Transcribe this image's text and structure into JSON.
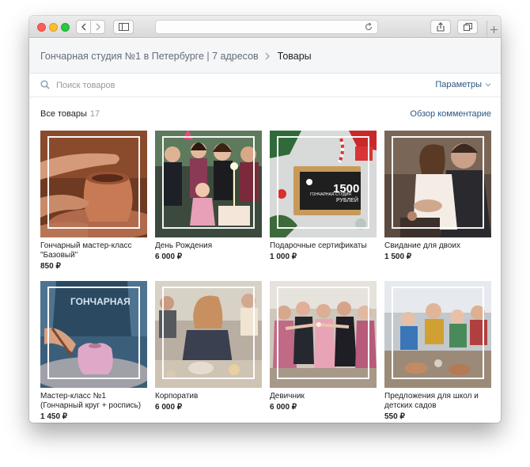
{
  "breadcrumb": {
    "group_name": "Гончарная студия №1 в Петербурге | 7 адресов",
    "current": "Товары"
  },
  "search": {
    "placeholder": "Поиск товаров",
    "params_label": "Параметры"
  },
  "section": {
    "title": "Все товары",
    "count": "17",
    "reviews_link": "Обзор комментарие"
  },
  "products": [
    {
      "name": "Гончарный мастер-класс \"Базовый\"",
      "price": "850 ₽"
    },
    {
      "name": "День Рождения",
      "price": "6 000 ₽"
    },
    {
      "name": "Подарочные сертификаты",
      "price": "1 000 ₽",
      "card_text": {
        "brand": "ГОНЧАРНАЯ СТУДИЯ",
        "amount": "1500",
        "currency": "РУБЛЕЙ"
      }
    },
    {
      "name": "Свидание для двоих",
      "price": "1 500 ₽"
    },
    {
      "name": "Мастер-класс №1 (Гончарный круг + роспись)",
      "price": "1 450 ₽",
      "apron_text": "ГОНЧАРНАЯ"
    },
    {
      "name": "Корпоратив",
      "price": "6 000 ₽"
    },
    {
      "name": "Девичник",
      "price": "6 000 ₽"
    },
    {
      "name": "Предложения для школ и детских садов",
      "price": "550 ₽"
    }
  ],
  "colors": {
    "link": "#2a5885",
    "muted": "#939aa3",
    "header_bg": "#f5f6f8",
    "text": "#222222"
  },
  "icons": [
    "back-icon",
    "forward-icon",
    "sidebar-icon",
    "reload-icon",
    "share-icon",
    "tabs-icon",
    "new-tab-icon",
    "search-icon",
    "chevron-right-icon",
    "chevron-down-icon"
  ]
}
